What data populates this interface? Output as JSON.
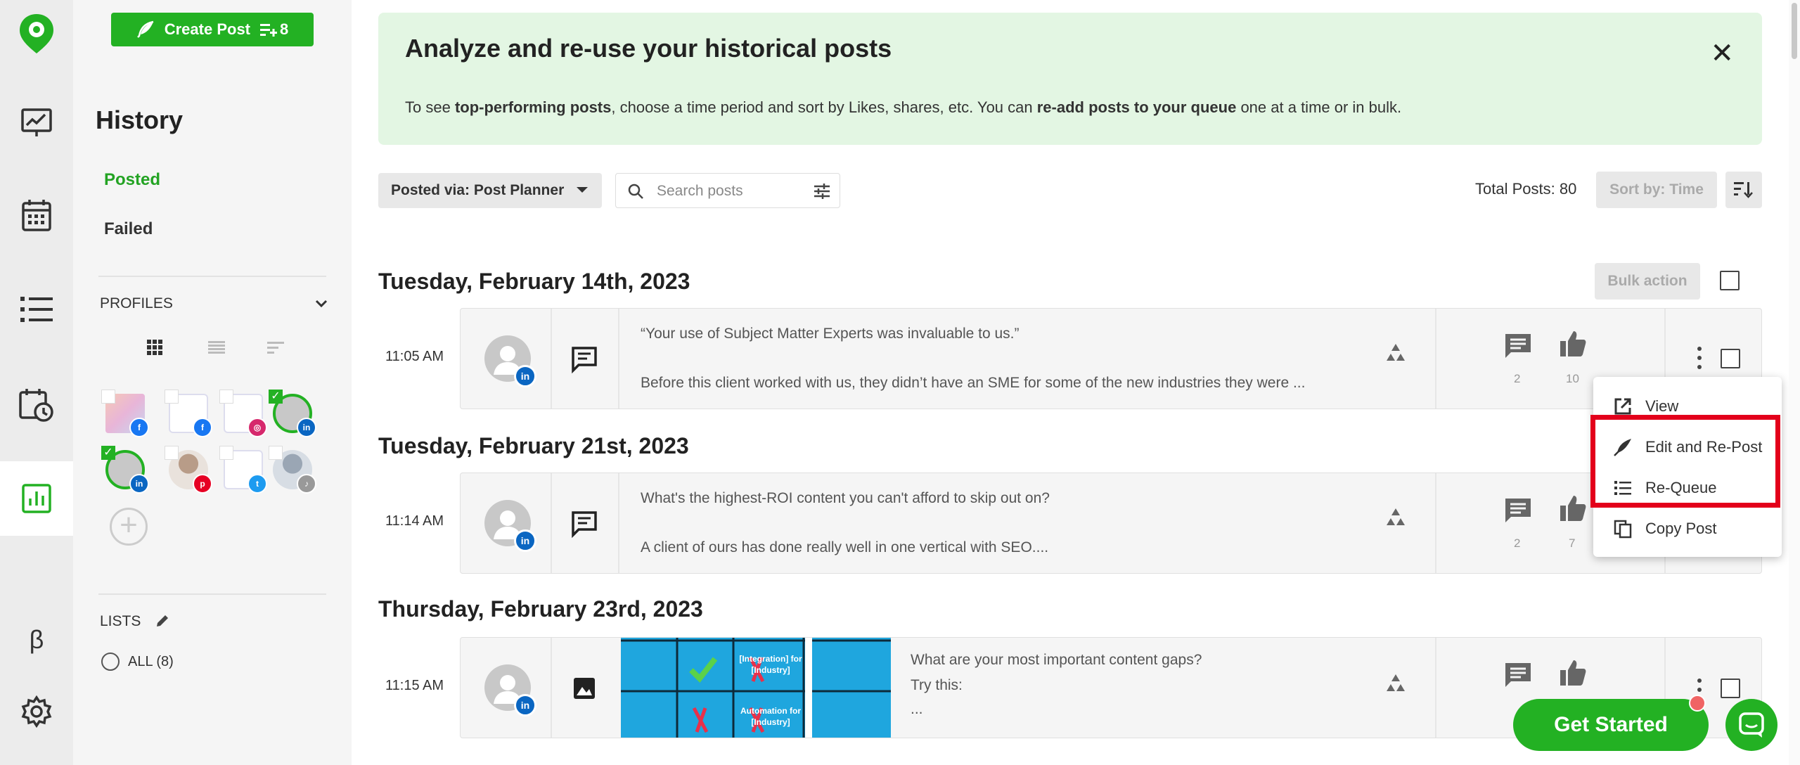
{
  "sidebar_rail": {
    "items": [
      "logo",
      "analytics",
      "calendar",
      "list",
      "schedule",
      "history-stats",
      "beta",
      "settings"
    ],
    "beta_label": "β"
  },
  "sidebar": {
    "create_post_label": "Create Post",
    "queue_count": "8",
    "title": "History",
    "nav": {
      "posted": "Posted",
      "failed": "Failed"
    },
    "profiles_label": "PROFILES",
    "profiles": [
      {
        "network": "facebook",
        "checked": false
      },
      {
        "network": "facebook",
        "checked": false
      },
      {
        "network": "instagram",
        "checked": false
      },
      {
        "network": "linkedin",
        "checked": true
      },
      {
        "network": "linkedin",
        "checked": true
      },
      {
        "network": "pinterest",
        "checked": false
      },
      {
        "network": "twitter",
        "checked": false
      },
      {
        "network": "tiktok",
        "checked": false
      }
    ],
    "lists_label": "LISTS",
    "lists_all": "ALL (8)"
  },
  "banner": {
    "title": "Analyze and re-use your historical posts",
    "text_parts": [
      "To see ",
      "top-performing posts",
      ", choose a time period and sort by Likes, shares, etc. You can ",
      "re-add posts to your queue",
      " one at a time or in bulk."
    ]
  },
  "toolbar": {
    "posted_via": "Posted via: Post Planner",
    "search_placeholder": "Search posts",
    "total_posts": "Total Posts: 80",
    "sort_by": "Sort by: Time",
    "bulk_action": "Bulk action"
  },
  "groups": [
    {
      "date": "Tuesday, February 14th, 2023",
      "time": "11:05 AM",
      "line1": "“Your use of Subject Matter Experts was invaluable to us.”",
      "line2": "Before this client worked with us, they didn’t have an SME for some of the new industries they were ...",
      "comments": "2",
      "likes": "10"
    },
    {
      "date": "Tuesday, February 21st, 2023",
      "time": "11:14 AM",
      "line1": "What's the highest-ROI content you can't afford to skip out on?",
      "line2": "A client of ours has done really well in one vertical with SEO....",
      "comments": "2",
      "likes": "7"
    },
    {
      "date": "Thursday, February 23rd, 2023",
      "time": "11:15 AM",
      "line1": "What are your most important content gaps?",
      "line2": "Try this:",
      "line3": "...",
      "thumb_label_1": "[Integration] for [Industry]",
      "thumb_label_2": "Automation for [Industry]"
    }
  ],
  "context_menu": {
    "view": "View",
    "edit_repost": "Edit and Re-Post",
    "requeue": "Re-Queue",
    "copy_post": "Copy Post"
  },
  "get_started": "Get Started",
  "colors": {
    "brand_green": "#23b123",
    "highlight_red": "#e3001b",
    "linkedin": "#0a66c2"
  }
}
